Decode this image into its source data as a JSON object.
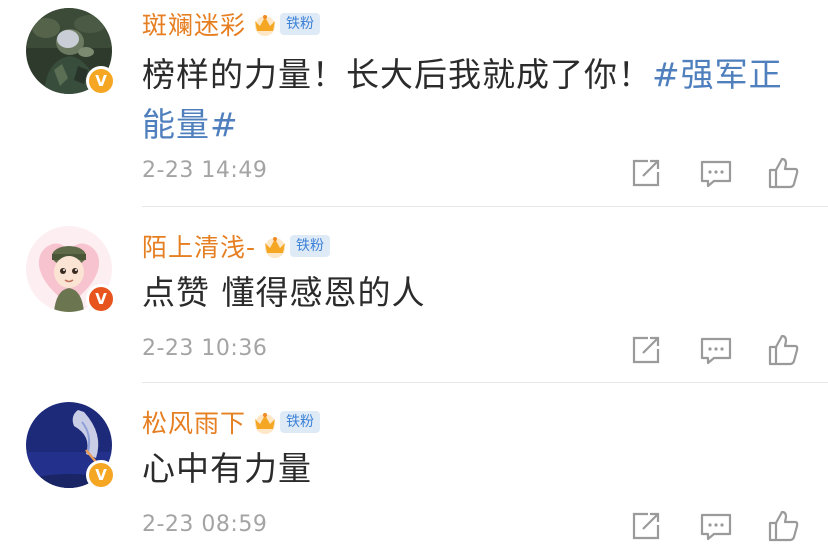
{
  "comments": [
    {
      "username": "斑斓迷彩",
      "badge": "铁粉",
      "text_lines": [
        "榜样的力量！长大后我就成了你！",
        "能量"
      ],
      "hashtag_part1": "#强军正",
      "hashtag_part2": "#",
      "time": "2-23 14:49",
      "avatar_icon": "avatar-soldier-camo",
      "verified_color": "#f5a623"
    },
    {
      "username": "陌上清浅-",
      "badge": "铁粉",
      "text": "点赞 懂得感恩的人",
      "time": "2-23 10:36",
      "avatar_icon": "avatar-cartoon-soldier-heart",
      "verified_color": "#e8541e"
    },
    {
      "username": "松风雨下",
      "badge": "铁粉",
      "text": "心中有力量",
      "time": "2-23 08:59",
      "avatar_icon": "avatar-blue-night",
      "verified_color": "#f5a623"
    }
  ],
  "icons": {
    "share": "share-icon",
    "comment": "comment-icon",
    "like": "like-icon"
  },
  "colors": {
    "username": "#e67f22",
    "hashtag": "#4f7fbd",
    "badge_bg": "#dfeaf7",
    "badge_text": "#3d82d6",
    "meta": "#a4a4a4"
  }
}
